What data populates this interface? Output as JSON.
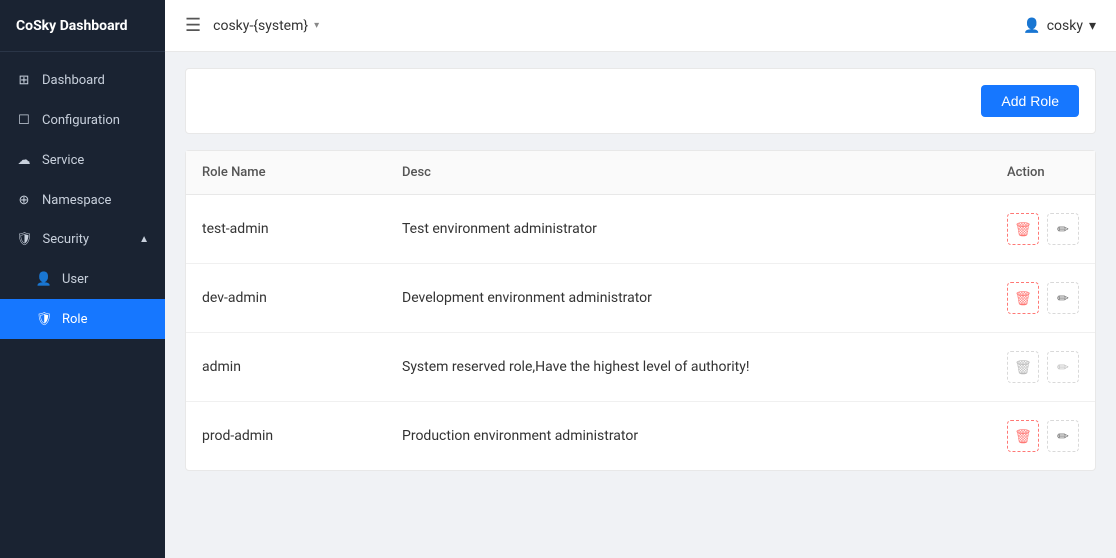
{
  "app": {
    "title": "CoSky Dashboard"
  },
  "topbar": {
    "selector_label": "cosky-{system}",
    "user_label": "cosky"
  },
  "sidebar": {
    "items": [
      {
        "id": "dashboard",
        "label": "Dashboard",
        "icon": "grid"
      },
      {
        "id": "configuration",
        "label": "Configuration",
        "icon": "doc"
      },
      {
        "id": "service",
        "label": "Service",
        "icon": "cloud"
      },
      {
        "id": "namespace",
        "label": "Namespace",
        "icon": "tag"
      },
      {
        "id": "security",
        "label": "Security",
        "icon": "shield",
        "expanded": true
      },
      {
        "id": "user",
        "label": "User",
        "icon": "user",
        "sub": true
      },
      {
        "id": "role",
        "label": "Role",
        "icon": "shield-small",
        "sub": true,
        "active": true
      }
    ]
  },
  "content": {
    "add_role_btn": "Add Role",
    "table": {
      "columns": [
        {
          "key": "name",
          "label": "Role Name"
        },
        {
          "key": "desc",
          "label": "Desc"
        },
        {
          "key": "action",
          "label": "Action"
        }
      ],
      "rows": [
        {
          "name": "test-admin",
          "desc": "Test environment administrator",
          "deletable": true,
          "editable": true
        },
        {
          "name": "dev-admin",
          "desc": "Development environment administrator",
          "deletable": true,
          "editable": true
        },
        {
          "name": "admin",
          "desc": "System reserved role,Have the highest level of authority!",
          "deletable": false,
          "editable": false
        },
        {
          "name": "prod-admin",
          "desc": "Production environment administrator",
          "deletable": true,
          "editable": true
        }
      ]
    }
  }
}
